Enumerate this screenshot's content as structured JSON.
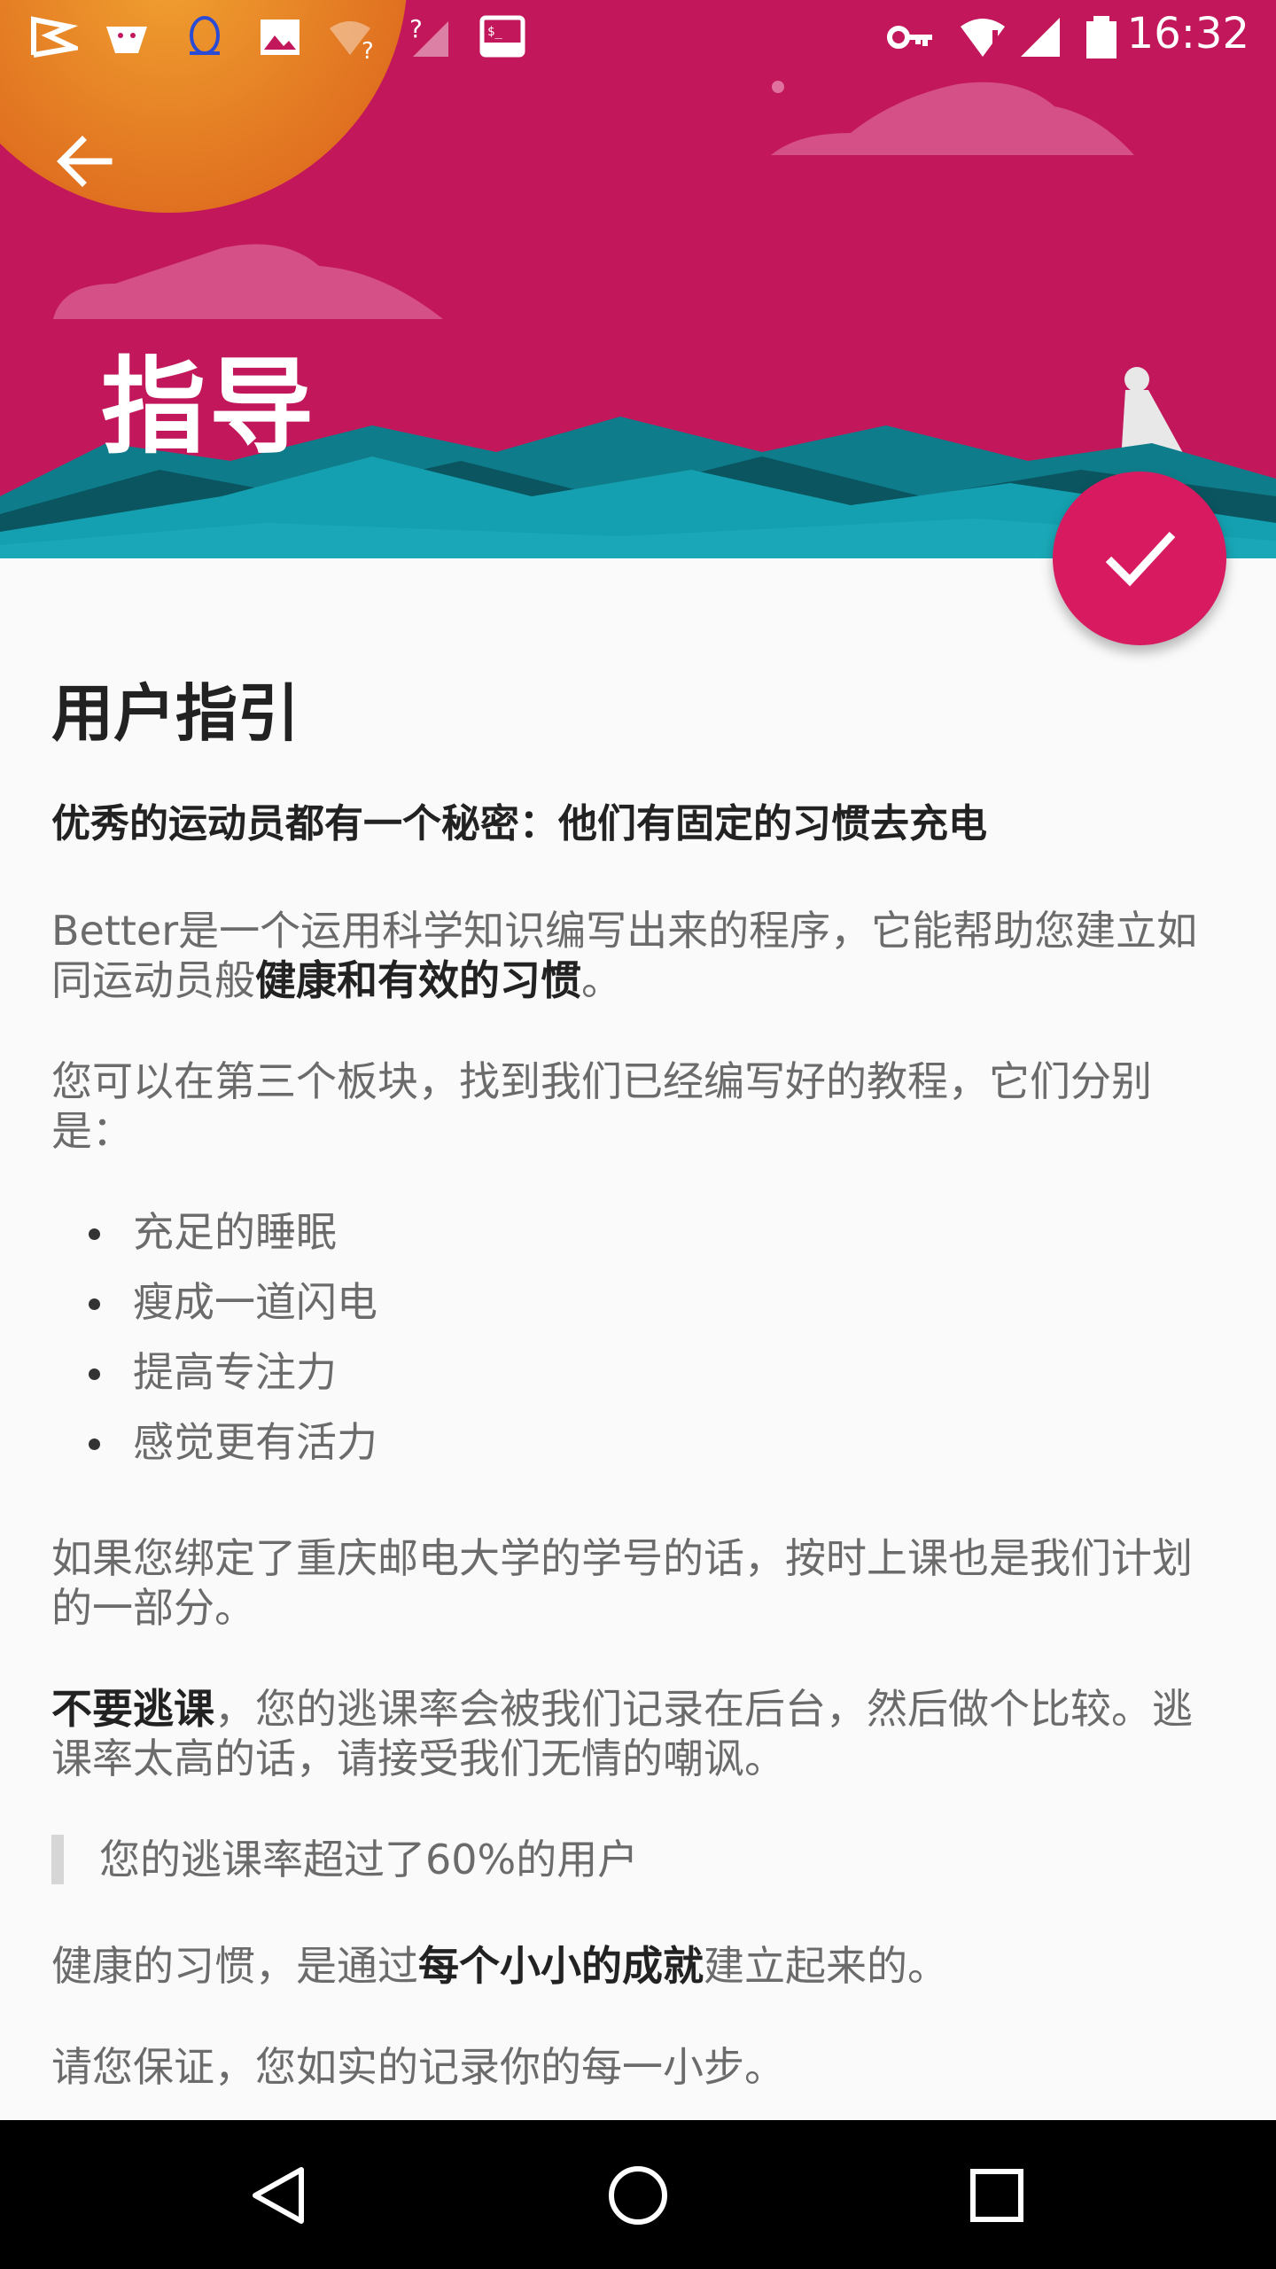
{
  "status_bar": {
    "time": "16:32",
    "left_icons": [
      "notification-flag-icon",
      "android-robot-icon",
      "qq-penguin-icon",
      "image-icon",
      "wifi-question-icon",
      "signal-question-icon",
      "terminal-icon"
    ],
    "right_icons": [
      "vpn-key-icon",
      "wifi-alert-icon",
      "cell-signal-icon",
      "battery-icon"
    ]
  },
  "header": {
    "title": "指导",
    "background_color": "#c2185b",
    "fab_color": "#d81b60"
  },
  "content": {
    "heading": "用户指引",
    "lead": "优秀的运动员都有一个秘密：他们有固定的习惯去充电",
    "p1_text": "Better是一个运用科学知识编写出来的程序，它能帮助您建立如同运动员般",
    "p1_bold": "健康和有效的习惯",
    "p1_end": "。",
    "p2": "您可以在第三个板块，找到我们已经编写好的教程，它们分别是：",
    "list": [
      "充足的睡眠",
      "瘦成一道闪电",
      "提高专注力",
      "感觉更有活力"
    ],
    "p3": "如果您绑定了重庆邮电大学的学号的话，按时上课也是我们计划的一部分。",
    "p4_bold": "不要逃课",
    "p4_text": "，您的逃课率会被我们记录在后台，然后做个比较。逃课率太高的话，请接受我们无情的嘲讽。",
    "quote": "您的逃课率超过了60%的用户",
    "p5_text": "健康的习惯，是通过",
    "p5_bold": "每个小小的成就",
    "p5_end": "建立起来的。",
    "p6": "请您保证，您如实的记录你的每一小步。"
  },
  "nav_bar": {
    "buttons": [
      "back-triangle-icon",
      "home-circle-icon",
      "recents-square-icon"
    ]
  }
}
